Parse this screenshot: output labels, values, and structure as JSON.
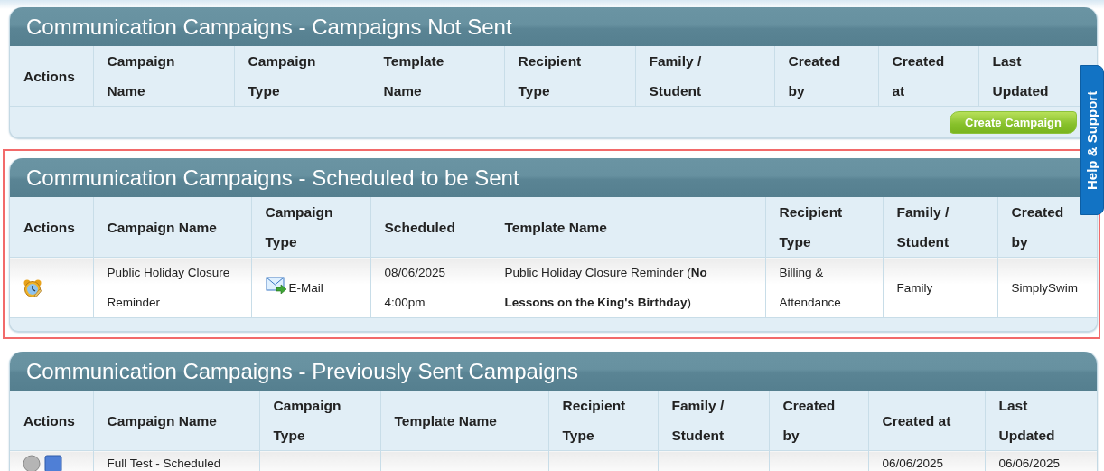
{
  "panels": [
    {
      "title": "Communication Campaigns - Campaigns Not Sent",
      "highlighted": false,
      "columns": [
        "Actions",
        "Campaign\nName",
        "Campaign\nType",
        "Template\nName",
        "Recipient\nType",
        "Family /\nStudent",
        "Created\nby",
        "Created\nat",
        "Last\nUpdated"
      ],
      "button": "Create Campaign"
    },
    {
      "title": "Communication Campaigns - Scheduled to be Sent",
      "highlighted": true,
      "columns": [
        "Actions",
        "Campaign Name",
        "Campaign\nType",
        "Scheduled",
        "Template Name",
        "Recipient\nType",
        "Family /\nStudent",
        "Created\nby"
      ],
      "rows": [
        {
          "cells": [
            {
              "kind": "actions",
              "icons": [
                {
                  "kind": "alarm"
                }
              ]
            },
            {
              "kind": "text",
              "text": "Public Holiday Closure\nReminder"
            },
            {
              "kind": "email",
              "text": "E-Mail"
            },
            {
              "kind": "text",
              "text": "08/06/2025\n4:00pm"
            },
            {
              "kind": "rich",
              "text": "Public Holiday Closure Reminder (**No Lessons on the King's Birthday**)"
            },
            {
              "kind": "text",
              "text": "Billing &\nAttendance"
            },
            {
              "kind": "text",
              "text": "Family"
            },
            {
              "kind": "text",
              "text": "SimplySwim"
            }
          ]
        }
      ]
    },
    {
      "title": "Communication Campaigns - Previously Sent Campaigns",
      "highlighted": false,
      "columns": [
        "Actions",
        "Campaign Name",
        "Campaign\nType",
        "Template Name",
        "Recipient\nType",
        "Family /\nStudent",
        "Created\nby",
        "Created at",
        "Last\nUpdated"
      ],
      "rows": [
        {
          "cells": [
            {
              "kind": "actions",
              "icons": [
                {
                  "kind": "circle"
                },
                {
                  "kind": "square"
                }
              ]
            },
            {
              "kind": "text",
              "text": "Full Test - Scheduled"
            },
            {
              "kind": "text",
              "text": ""
            },
            {
              "kind": "text",
              "text": ""
            },
            {
              "kind": "text",
              "text": ""
            },
            {
              "kind": "text",
              "text": ""
            },
            {
              "kind": "text",
              "text": ""
            },
            {
              "kind": "text",
              "text": "06/06/2025"
            },
            {
              "kind": "text",
              "text": "06/06/2025"
            }
          ]
        }
      ]
    }
  ],
  "help_tab": {
    "label": "Help & Support"
  }
}
